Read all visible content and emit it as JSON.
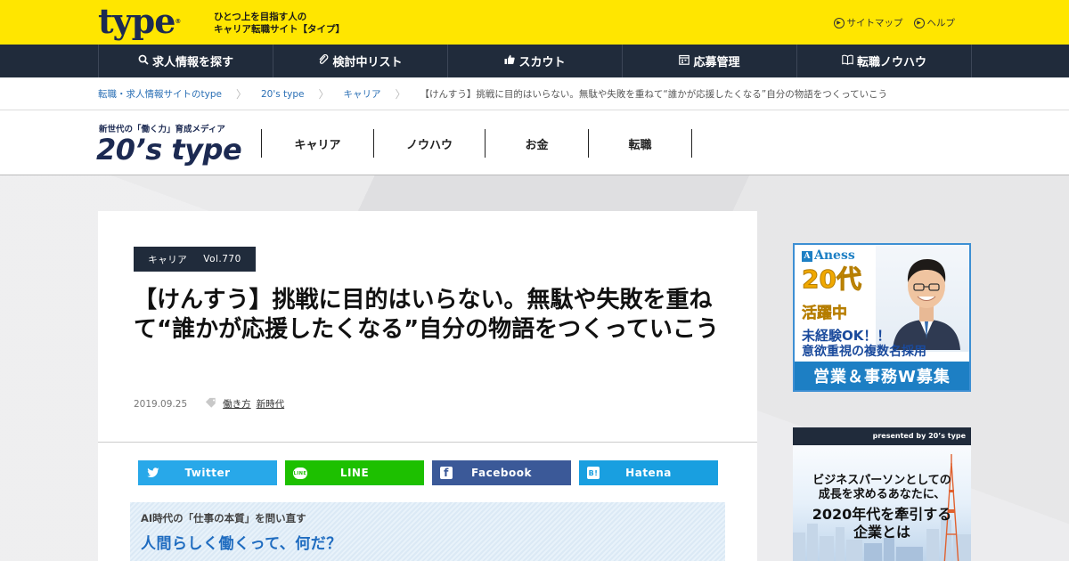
{
  "site": {
    "logo": "type",
    "logo_mark": "®",
    "tagline_line1": "ひとつ上を目指す人の",
    "tagline_line2": "キャリア転職サイト【タイプ】",
    "util_links": [
      {
        "label": "サイトマップ"
      },
      {
        "label": "ヘルプ"
      }
    ]
  },
  "mainnav": {
    "items": [
      {
        "label": "求人情報を探す",
        "icon": "search-icon"
      },
      {
        "label": "検討中リスト",
        "icon": "clip-icon"
      },
      {
        "label": "スカウト",
        "icon": "thumbs-up-icon"
      },
      {
        "label": "応募管理",
        "icon": "calendar-icon"
      },
      {
        "label": "転職ノウハウ",
        "icon": "book-icon"
      }
    ]
  },
  "breadcrumb": {
    "items": [
      "転職・求人情報サイトのtype",
      "20's type",
      "キャリア"
    ],
    "current": "【けんすう】挑戦に目的はいらない。無駄や失敗を重ねて“誰かが応援したくなる”自分の物語をつくっていこう"
  },
  "media": {
    "tag": "新世代の「働く力」育成メディア",
    "logo": "20’s type",
    "nav": [
      "キャリア",
      "ノウハウ",
      "お金",
      "転職"
    ]
  },
  "article": {
    "category": "キャリア",
    "vol": "Vol.770",
    "title": "【けんすう】挑戦に目的はいらない。無駄や失敗を重ねて“誰かが応援したくなる”自分の物語をつくっていこう",
    "date": "2019.09.25",
    "tags": [
      "働き方",
      "新時代"
    ],
    "share": [
      {
        "label": "Twitter",
        "icon": "twitter-bird-icon",
        "color": "#28a8e9"
      },
      {
        "label": "LINE",
        "icon": "line-icon",
        "color": "#1dc000"
      },
      {
        "label": "Facebook",
        "icon": "facebook-icon",
        "color": "#3b5998"
      },
      {
        "label": "Hatena",
        "icon": "hatena-icon",
        "color": "#199fe0"
      }
    ],
    "promo_kicker": "AI時代の「仕事の本質」を問い直す",
    "promo_title": "人間らしく働くって、何だ？"
  },
  "ads": {
    "ad1": {
      "brand": "Aness",
      "age": "20代",
      "active": "活躍中",
      "line1": "未経験OK！！",
      "line2": "意欲重視の複数名採用",
      "bar": "営業＆事務W募集"
    },
    "ad2": {
      "presented": "presented by 20’s type",
      "l1": "ビジネスパーソンとしての",
      "l2": "成長を求めるあなたに、",
      "l3": "2020年代を牽引する",
      "l4": "企業とは"
    }
  },
  "colors": {
    "brand_yellow": "#ffe600",
    "navy": "#202b3b",
    "link_blue": "#2a6fb5"
  }
}
